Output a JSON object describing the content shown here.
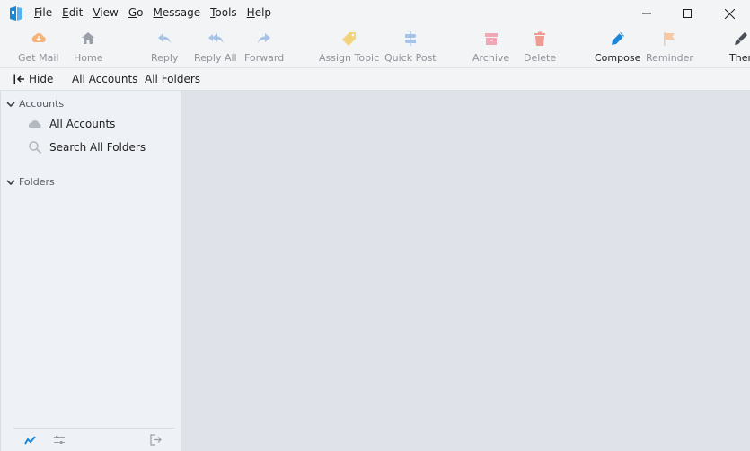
{
  "menu": [
    {
      "key": "F",
      "rest": "ile"
    },
    {
      "key": "E",
      "rest": "dit"
    },
    {
      "key": "V",
      "rest": "iew"
    },
    {
      "key": "G",
      "rest": "o"
    },
    {
      "key": "M",
      "rest": "essage"
    },
    {
      "key": "T",
      "rest": "ools"
    },
    {
      "key": "H",
      "rest": "elp"
    }
  ],
  "toolbar": {
    "get_mail": "Get Mail",
    "home": "Home",
    "reply": "Reply",
    "reply_all": "Reply All",
    "forward": "Forward",
    "assign_topic": "Assign Topic",
    "quick_post": "Quick Post",
    "archive": "Archive",
    "delete": "Delete",
    "compose": "Compose",
    "reminder": "Reminder",
    "themes": "Ther"
  },
  "pane_header": {
    "hide": "Hide",
    "all_accounts": "All Accounts",
    "all_folders": "All Folders"
  },
  "sidebar": {
    "accounts_section": "Accounts",
    "items": [
      "All Accounts",
      "Search All Folders"
    ],
    "folders_section": "Folders"
  },
  "colors": {
    "accent_blue": "#1b87d6",
    "get_mail_orange": "#f3b37a",
    "assign_topic_yellow": "#f2d27a",
    "archive_pink": "#f0a7b6",
    "delete_red": "#ef9a92",
    "reminder_orange": "#f6c9a4",
    "disabled_blue": "#a8c3e8"
  }
}
